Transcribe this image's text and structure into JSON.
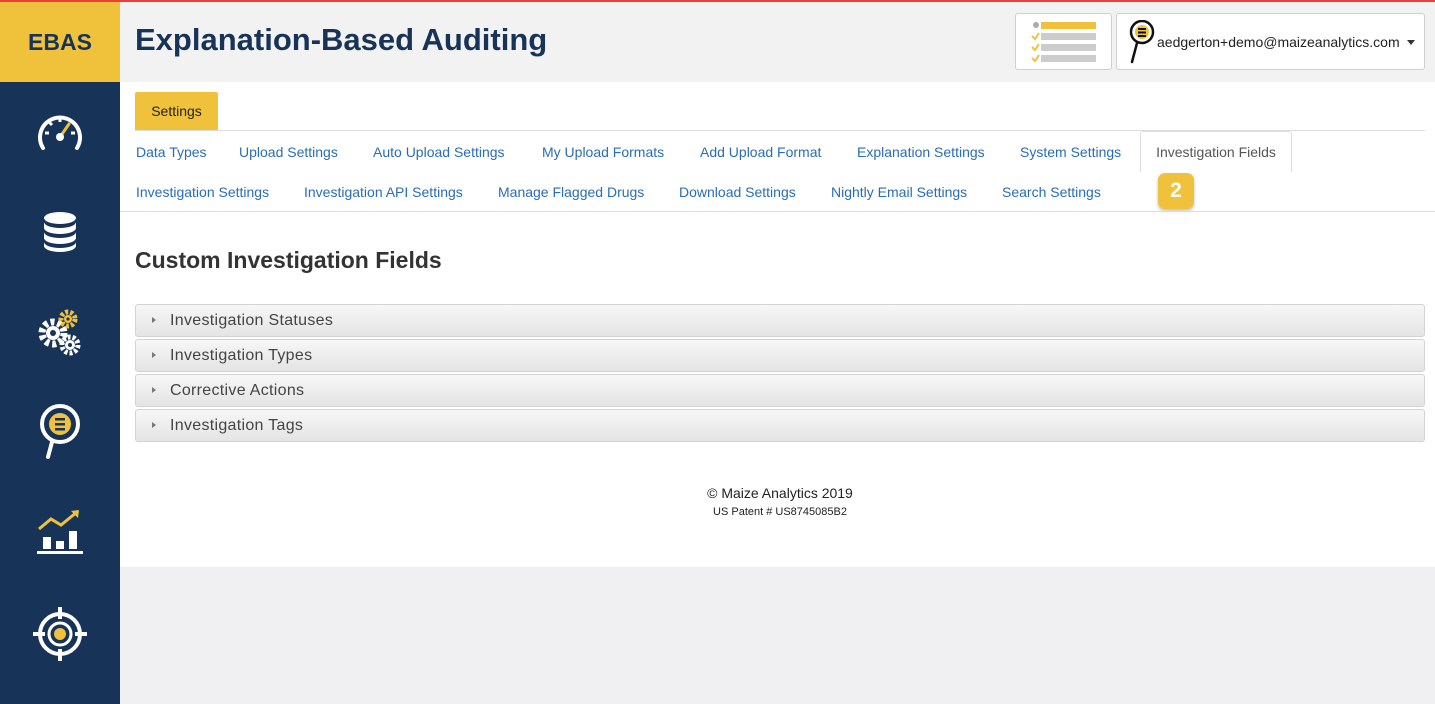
{
  "brand": "EBAS",
  "app_title": "Explanation-Based Auditing",
  "colors": {
    "sidebar": "#173358",
    "accent": "#f0c23c",
    "link": "#2a6db0",
    "top_border": "#e8413a"
  },
  "sidebar": {
    "items": [
      {
        "icon": "speedometer-icon"
      },
      {
        "icon": "database-icon"
      },
      {
        "icon": "gears-icon"
      },
      {
        "icon": "magnifier-list-icon"
      },
      {
        "icon": "analytics-chart-icon"
      },
      {
        "icon": "target-icon"
      }
    ]
  },
  "header": {
    "tasks_icon": "checklist-icon",
    "user_icon": "magnifier-list-icon",
    "user_email": "aedgerton+demo@maizeanalytics.com"
  },
  "main_tab": "Settings",
  "subtabs_row1": [
    "Data Types",
    "Upload Settings",
    "Auto Upload Settings",
    "My Upload Formats",
    "Add Upload Format",
    "Explanation Settings",
    "System Settings"
  ],
  "active_subtab": "Investigation Fields",
  "subtabs_row2": [
    "Investigation Settings",
    "Investigation API Settings",
    "Manage Flagged Drugs",
    "Download Settings",
    "Nightly Email Settings",
    "Search Settings"
  ],
  "step_badge": "2",
  "section_title": "Custom Investigation Fields",
  "accordion": [
    "Investigation Statuses",
    "Investigation Types",
    "Corrective Actions",
    "Investigation Tags"
  ],
  "footer": {
    "copyright": "© Maize Analytics 2019",
    "patent": "US Patent # US8745085B2"
  }
}
